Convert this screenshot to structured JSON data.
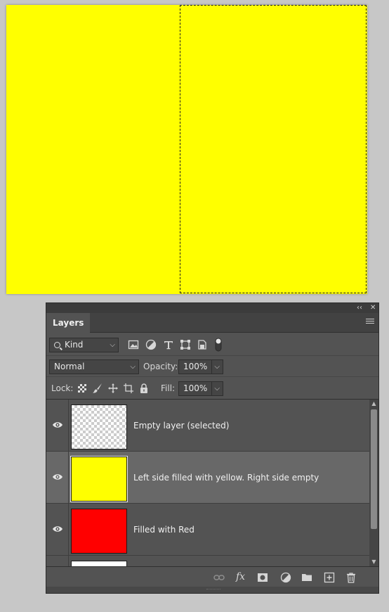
{
  "panel": {
    "tab_label": "Layers",
    "collapse_icon": "double-chevron-left-icon",
    "close_icon": "close-icon",
    "collapse_glyph": "‹‹",
    "close_glyph": "✕"
  },
  "filter": {
    "kind_label": "Kind",
    "icons": [
      "pixel-filter-icon",
      "adjustment-filter-icon",
      "type-filter-icon",
      "shape-filter-icon",
      "smart-object-filter-icon",
      "filter-toggle-icon"
    ]
  },
  "blend": {
    "mode": "Normal",
    "opacity_label": "Opacity:",
    "opacity_value": "100%"
  },
  "lock": {
    "label": "Lock:",
    "icons": [
      "lock-transparent-icon",
      "lock-image-icon",
      "lock-position-icon",
      "lock-artboard-icon",
      "lock-all-icon"
    ],
    "fill_label": "Fill:",
    "fill_value": "100%"
  },
  "layers": [
    {
      "name": "Empty layer (selected)",
      "thumb": "transparent",
      "visible": true
    },
    {
      "name": "Left side filled with yellow. Right side empty",
      "thumb": "#ffff00",
      "visible": true,
      "selected": true
    },
    {
      "name": "Filled with Red",
      "thumb": "#ff0000",
      "visible": true
    },
    {
      "name": "",
      "thumb": "#ffffff",
      "visible": true
    }
  ],
  "bottom_icons": [
    "link-layers-icon",
    "fx-icon",
    "mask-icon",
    "adjustment-layer-icon",
    "group-folder-icon",
    "new-layer-icon",
    "trash-icon"
  ],
  "fx_label": "fx",
  "colors": {
    "canvas": "#ffff00",
    "panel": "#535353",
    "selected_row": "#686868"
  }
}
